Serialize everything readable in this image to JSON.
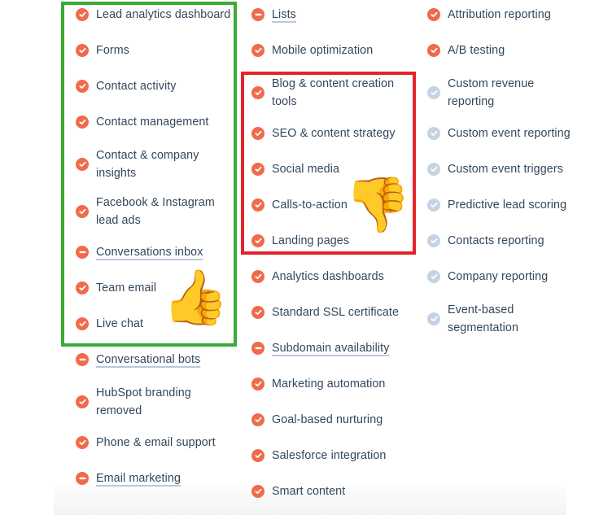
{
  "colors": {
    "included": "#f06b4b",
    "not_included": "#f06b4b",
    "unavailable": "#c5d2e1",
    "text": "#33475b",
    "green_box": "#3aaa35",
    "red_box": "#e3242b"
  },
  "icons": {
    "check": "check-circle-icon",
    "minus": "minus-circle-icon",
    "check_muted": "check-circle-muted-icon"
  },
  "columns": [
    {
      "items": [
        {
          "label": "Lead analytics dashboard",
          "status": "check"
        },
        {
          "label": "Forms",
          "status": "check"
        },
        {
          "label": "Contact activity",
          "status": "check"
        },
        {
          "label": "Contact management",
          "status": "check"
        },
        {
          "label": "Contact & company insights",
          "status": "check"
        },
        {
          "label": "Facebook & Instagram lead ads",
          "status": "check"
        },
        {
          "label": "Conversations inbox",
          "status": "minus"
        },
        {
          "label": "Team email",
          "status": "check"
        },
        {
          "label": "Live chat",
          "status": "check"
        },
        {
          "label": "Conversational bots",
          "status": "minus"
        },
        {
          "label": "HubSpot branding removed",
          "status": "check"
        },
        {
          "label": "Phone & email support",
          "status": "check"
        },
        {
          "label": "Email marketing",
          "status": "minus"
        }
      ]
    },
    {
      "items": [
        {
          "label": "Lists",
          "status": "minus"
        },
        {
          "label": "Mobile optimization",
          "status": "check"
        },
        {
          "label": "Blog & content creation tools",
          "status": "check"
        },
        {
          "label": "SEO & content strategy",
          "status": "check"
        },
        {
          "label": "Social media",
          "status": "check"
        },
        {
          "label": "Calls-to-action",
          "status": "check"
        },
        {
          "label": "Landing pages",
          "status": "check"
        },
        {
          "label": "Analytics dashboards",
          "status": "check"
        },
        {
          "label": "Standard SSL certificate",
          "status": "check"
        },
        {
          "label": "Subdomain availability",
          "status": "minus"
        },
        {
          "label": "Marketing automation",
          "status": "check"
        },
        {
          "label": "Goal-based nurturing",
          "status": "check"
        },
        {
          "label": "Salesforce integration",
          "status": "check"
        },
        {
          "label": "Smart content",
          "status": "check"
        }
      ]
    },
    {
      "items": [
        {
          "label": "Attribution reporting",
          "status": "check"
        },
        {
          "label": "A/B testing",
          "status": "check"
        },
        {
          "label": "Custom revenue reporting",
          "status": "muted"
        },
        {
          "label": "Custom event reporting",
          "status": "muted"
        },
        {
          "label": "Custom event triggers",
          "status": "muted"
        },
        {
          "label": "Predictive lead scoring",
          "status": "muted"
        },
        {
          "label": "Contacts reporting",
          "status": "muted"
        },
        {
          "label": "Company reporting",
          "status": "muted"
        },
        {
          "label": "Event-based segmentation",
          "status": "muted"
        }
      ]
    }
  ],
  "annotations": {
    "thumbs_up": "👍",
    "thumbs_down": "👎"
  }
}
